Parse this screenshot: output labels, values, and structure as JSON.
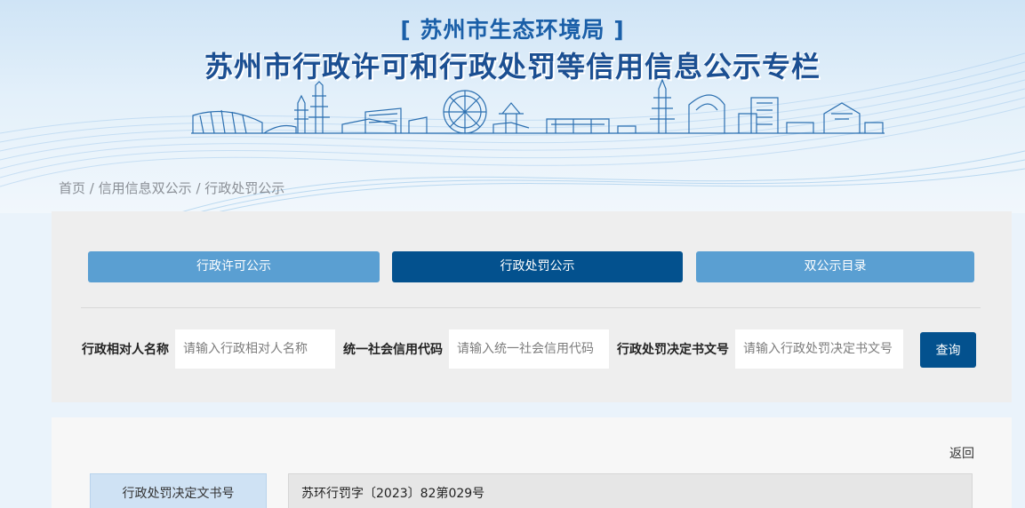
{
  "header": {
    "org": "[ 苏州市生态环境局 ]",
    "title": "苏州市行政许可和行政处罚等信用信息公示专栏"
  },
  "breadcrumb": {
    "items": [
      "首页",
      "信用信息双公示",
      "行政处罚公示"
    ],
    "separator": "/"
  },
  "tabs": [
    {
      "label": "行政许可公示",
      "active": false
    },
    {
      "label": "行政处罚公示",
      "active": true
    },
    {
      "label": "双公示目录",
      "active": false
    }
  ],
  "search": {
    "fields": [
      {
        "label": "行政相对人名称",
        "placeholder": "请输入行政相对人名称"
      },
      {
        "label": "统一社会信用代码",
        "placeholder": "请输入统一社会信用代码"
      },
      {
        "label": "行政处罚决定书文号",
        "placeholder": "请输入行政处罚决定书文号"
      }
    ],
    "button": "查询"
  },
  "detail": {
    "back": "返回",
    "rows": [
      {
        "label": "行政处罚决定文书号",
        "value": "苏环行罚字〔2023〕82第029号"
      }
    ]
  },
  "colors": {
    "primary": "#03518e",
    "tab_light": "#5a9fd2",
    "title": "#1b4f92"
  }
}
